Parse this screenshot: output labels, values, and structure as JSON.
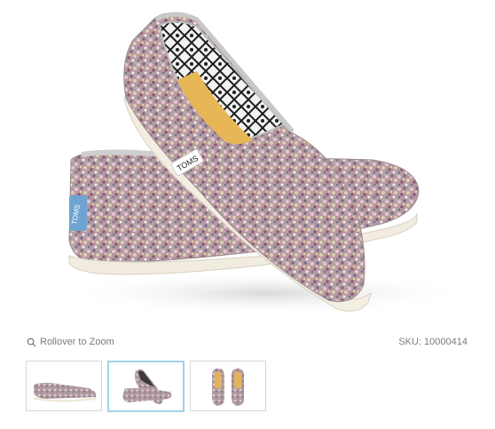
{
  "product_image": {
    "brand_tag": "TOMS",
    "heel_label": "TOMS"
  },
  "zoom": {
    "icon": "search-icon",
    "label": "Rollover to Zoom"
  },
  "sku": {
    "text": "SKU: 10000414"
  },
  "thumbnails": {
    "selected_index": 2,
    "items": [
      {
        "view": "side"
      },
      {
        "view": "pair-crossed"
      },
      {
        "view": "top-down"
      }
    ]
  },
  "colors": {
    "text_muted": "#7a7a7a",
    "thumb_border": "#d6d6d6",
    "thumb_selected_border": "#9fd3e8"
  }
}
